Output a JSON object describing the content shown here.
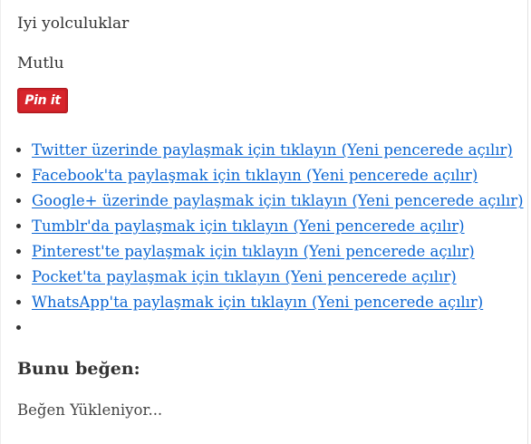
{
  "post": {
    "line1": "Iyi yolculuklar",
    "line2": "Mutlu"
  },
  "pinit": {
    "label": "Pin it",
    "color": "#cb2027"
  },
  "share": {
    "links": [
      "Twitter üzerinde paylaşmak için tıklayın (Yeni pencerede açılır)",
      "Facebook'ta paylaşmak için tıklayın (Yeni pencerede açılır)",
      "Google+ üzerinde paylaşmak için tıklayın (Yeni pencerede açılır)",
      "Tumblr'da paylaşmak için tıklayın (Yeni pencerede açılır)",
      "Pinterest'te paylaşmak için tıklayın (Yeni pencerede açılır)",
      "Pocket'ta paylaşmak için tıklayın (Yeni pencerede açılır)",
      "WhatsApp'ta paylaşmak için tıklayın (Yeni pencerede açılır)"
    ],
    "link_color": "#0b66d3"
  },
  "likes": {
    "heading": "Bunu beğen:",
    "loading": "Beğen Yükleniyor..."
  }
}
